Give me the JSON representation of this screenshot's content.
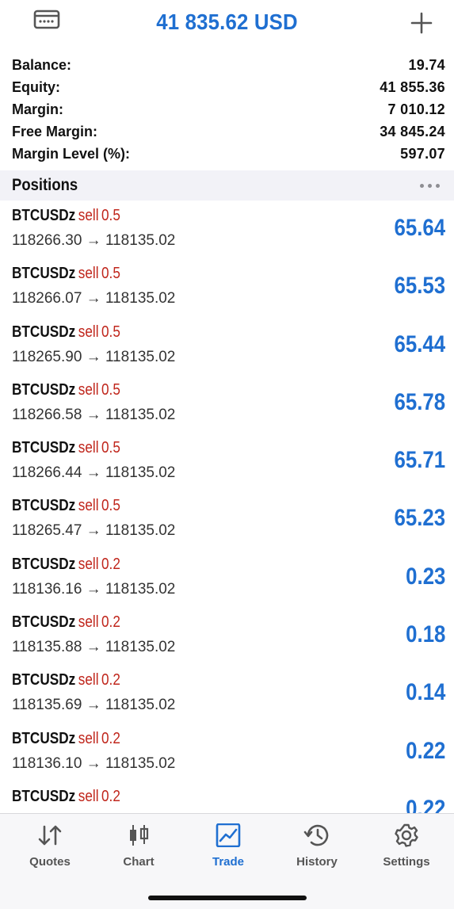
{
  "header": {
    "title": "41 835.62 USD",
    "left_icon": "wallet-icon",
    "right_icon": "plus-icon"
  },
  "account": [
    {
      "label": "Balance:",
      "value": "19.74"
    },
    {
      "label": "Equity:",
      "value": "41 855.36"
    },
    {
      "label": "Margin:",
      "value": "7 010.12"
    },
    {
      "label": "Free Margin:",
      "value": "34 845.24"
    },
    {
      "label": "Margin Level (%):",
      "value": "597.07"
    }
  ],
  "positions": {
    "title": "Positions",
    "menu_icon": "more-dots-icon",
    "items": [
      {
        "symbol": "BTCUSDz",
        "side": "sell",
        "volume": "0.5",
        "prices": "118266.30 → 118135.02",
        "profit": "65.64"
      },
      {
        "symbol": "BTCUSDz",
        "side": "sell",
        "volume": "0.5",
        "prices": "118266.07 → 118135.02",
        "profit": "65.53"
      },
      {
        "symbol": "BTCUSDz",
        "side": "sell",
        "volume": "0.5",
        "prices": "118265.90 → 118135.02",
        "profit": "65.44"
      },
      {
        "symbol": "BTCUSDz",
        "side": "sell",
        "volume": "0.5",
        "prices": "118266.58 → 118135.02",
        "profit": "65.78"
      },
      {
        "symbol": "BTCUSDz",
        "side": "sell",
        "volume": "0.5",
        "prices": "118266.44 → 118135.02",
        "profit": "65.71"
      },
      {
        "symbol": "BTCUSDz",
        "side": "sell",
        "volume": "0.5",
        "prices": "118265.47 → 118135.02",
        "profit": "65.23"
      },
      {
        "symbol": "BTCUSDz",
        "side": "sell",
        "volume": "0.2",
        "prices": "118136.16 → 118135.02",
        "profit": "0.23"
      },
      {
        "symbol": "BTCUSDz",
        "side": "sell",
        "volume": "0.2",
        "prices": "118135.88 → 118135.02",
        "profit": "0.18"
      },
      {
        "symbol": "BTCUSDz",
        "side": "sell",
        "volume": "0.2",
        "prices": "118135.69 → 118135.02",
        "profit": "0.14"
      },
      {
        "symbol": "BTCUSDz",
        "side": "sell",
        "volume": "0.2",
        "prices": "118136.10 → 118135.02",
        "profit": "0.22"
      },
      {
        "symbol": "BTCUSDz",
        "side": "sell",
        "volume": "0.2",
        "prices": "",
        "profit": "0.22"
      }
    ]
  },
  "tabs": [
    {
      "label": "Quotes",
      "icon": "quotes-arrows-icon",
      "active": false
    },
    {
      "label": "Chart",
      "icon": "candlestick-chart-icon",
      "active": false
    },
    {
      "label": "Trade",
      "icon": "trade-chart-icon",
      "active": true
    },
    {
      "label": "History",
      "icon": "history-clock-icon",
      "active": false
    },
    {
      "label": "Settings",
      "icon": "gear-icon",
      "active": false
    }
  ],
  "colors": {
    "accent": "#1f6fd1",
    "sell": "#c0261c",
    "section_bg": "#f2f2f7"
  }
}
